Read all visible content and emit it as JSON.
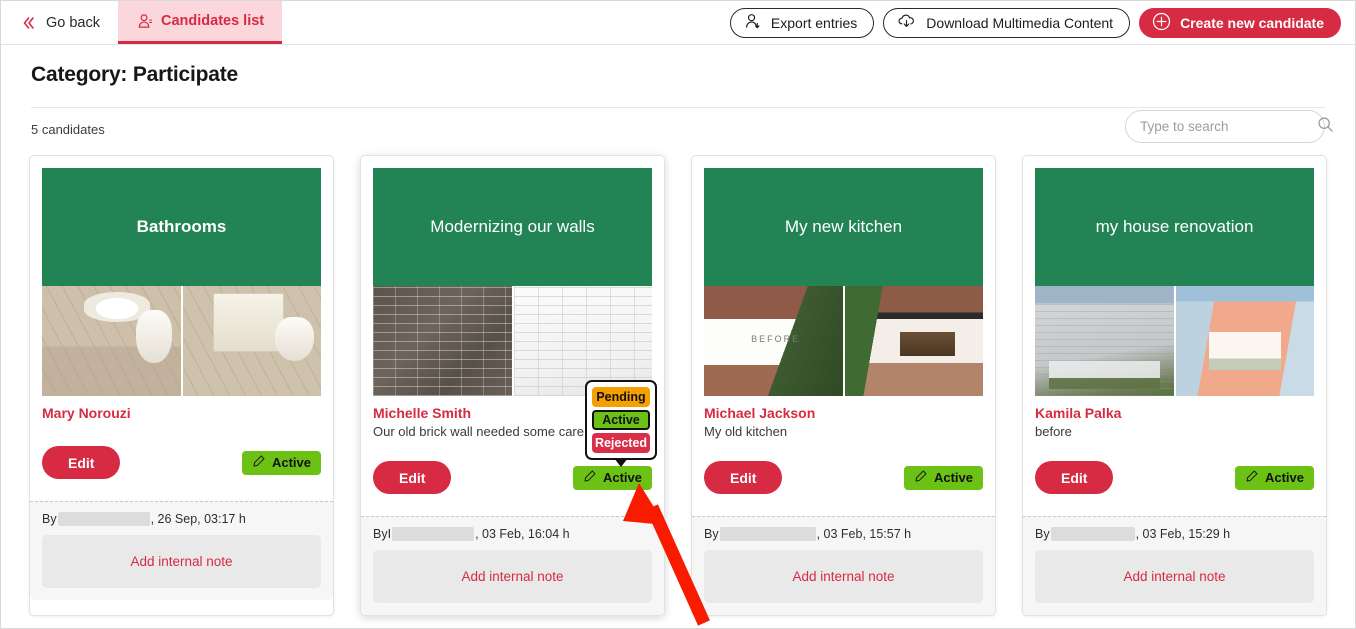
{
  "topbar": {
    "go_back_label": "Go back",
    "go_back_icon": "double-chevron-left-icon",
    "tab_label": "Candidates list",
    "tab_icon": "person-lines-icon",
    "export_label": "Export entries",
    "export_icon": "person-download-icon",
    "download_label": "Download Multimedia Content",
    "download_icon": "cloud-download-icon",
    "create_label": "Create new candidate",
    "create_icon": "plus-circle-icon"
  },
  "header": {
    "title": "Category: Participate",
    "count_text": "5 candidates"
  },
  "search": {
    "placeholder": "Type to search",
    "value": "",
    "icon": "search-icon"
  },
  "colors": {
    "accent_red": "#d62b42",
    "banner_green": "#228355",
    "status_green": "#6cc214",
    "status_orange": "#f5a002",
    "status_red": "#d83049",
    "annotation_red": "#f81b00"
  },
  "status_menu": {
    "visible": true,
    "attached_to_card": 2,
    "selected": "Active",
    "options": [
      {
        "label": "Pending",
        "state": "pending"
      },
      {
        "label": "Active",
        "state": "active"
      },
      {
        "label": "Rejected",
        "state": "rejected"
      }
    ]
  },
  "card_common": {
    "edit_label": "Edit",
    "status_label": "Active",
    "status_icon": "pencil-icon",
    "note_label": "Add internal note",
    "by_prefix": "By"
  },
  "cards": [
    {
      "title": "Bathrooms",
      "title_style": "bold",
      "author": "Mary Norouzi",
      "description": "",
      "status": "Active",
      "by_prefix": "By",
      "by_name_redacted": true,
      "by_name_visible": "",
      "timestamp": ", 26 Sep, 03:17 h",
      "note_label": "Add internal note",
      "thumb_left_alt": "bathroom-before-sink",
      "thumb_right_alt": "bathroom-after-vanity"
    },
    {
      "title": "Modernizing our walls",
      "title_style": "light",
      "author": "Michelle Smith",
      "description": "Our old brick wall needed some care...",
      "status": "Active",
      "by_prefix": "By",
      "by_name_redacted": true,
      "by_name_visible": "I",
      "timestamp": ", 03 Feb, 16:04 h",
      "note_label": "Add internal note",
      "thumb_left_alt": "dark-brick-wall",
      "thumb_right_alt": "white-brick-wall"
    },
    {
      "title": "My new kitchen",
      "title_style": "light",
      "author": "Michael Jackson",
      "description": "My old kitchen",
      "status": "Active",
      "by_prefix": "By",
      "by_name_redacted": true,
      "by_name_visible": "",
      "timestamp": ", 03 Feb, 15:57 h",
      "note_label": "Add internal note",
      "thumb_left_alt": "house-exterior-before",
      "thumb_right_alt": "kitchen-extension-after"
    },
    {
      "title": "my house renovation",
      "title_style": "light",
      "author": "Kamila Palka",
      "description": "before",
      "status": "Active",
      "by_prefix": "By",
      "by_name_redacted": true,
      "by_name_visible": "",
      "timestamp": ", 03 Feb, 15:29 h",
      "note_label": "Add internal note",
      "thumb_left_alt": "old-house-exterior",
      "thumb_right_alt": "renovated-house-exterior"
    }
  ],
  "annotation": {
    "type": "arrow",
    "color": "#f81b00",
    "points_to": "status-badge-card-2"
  }
}
